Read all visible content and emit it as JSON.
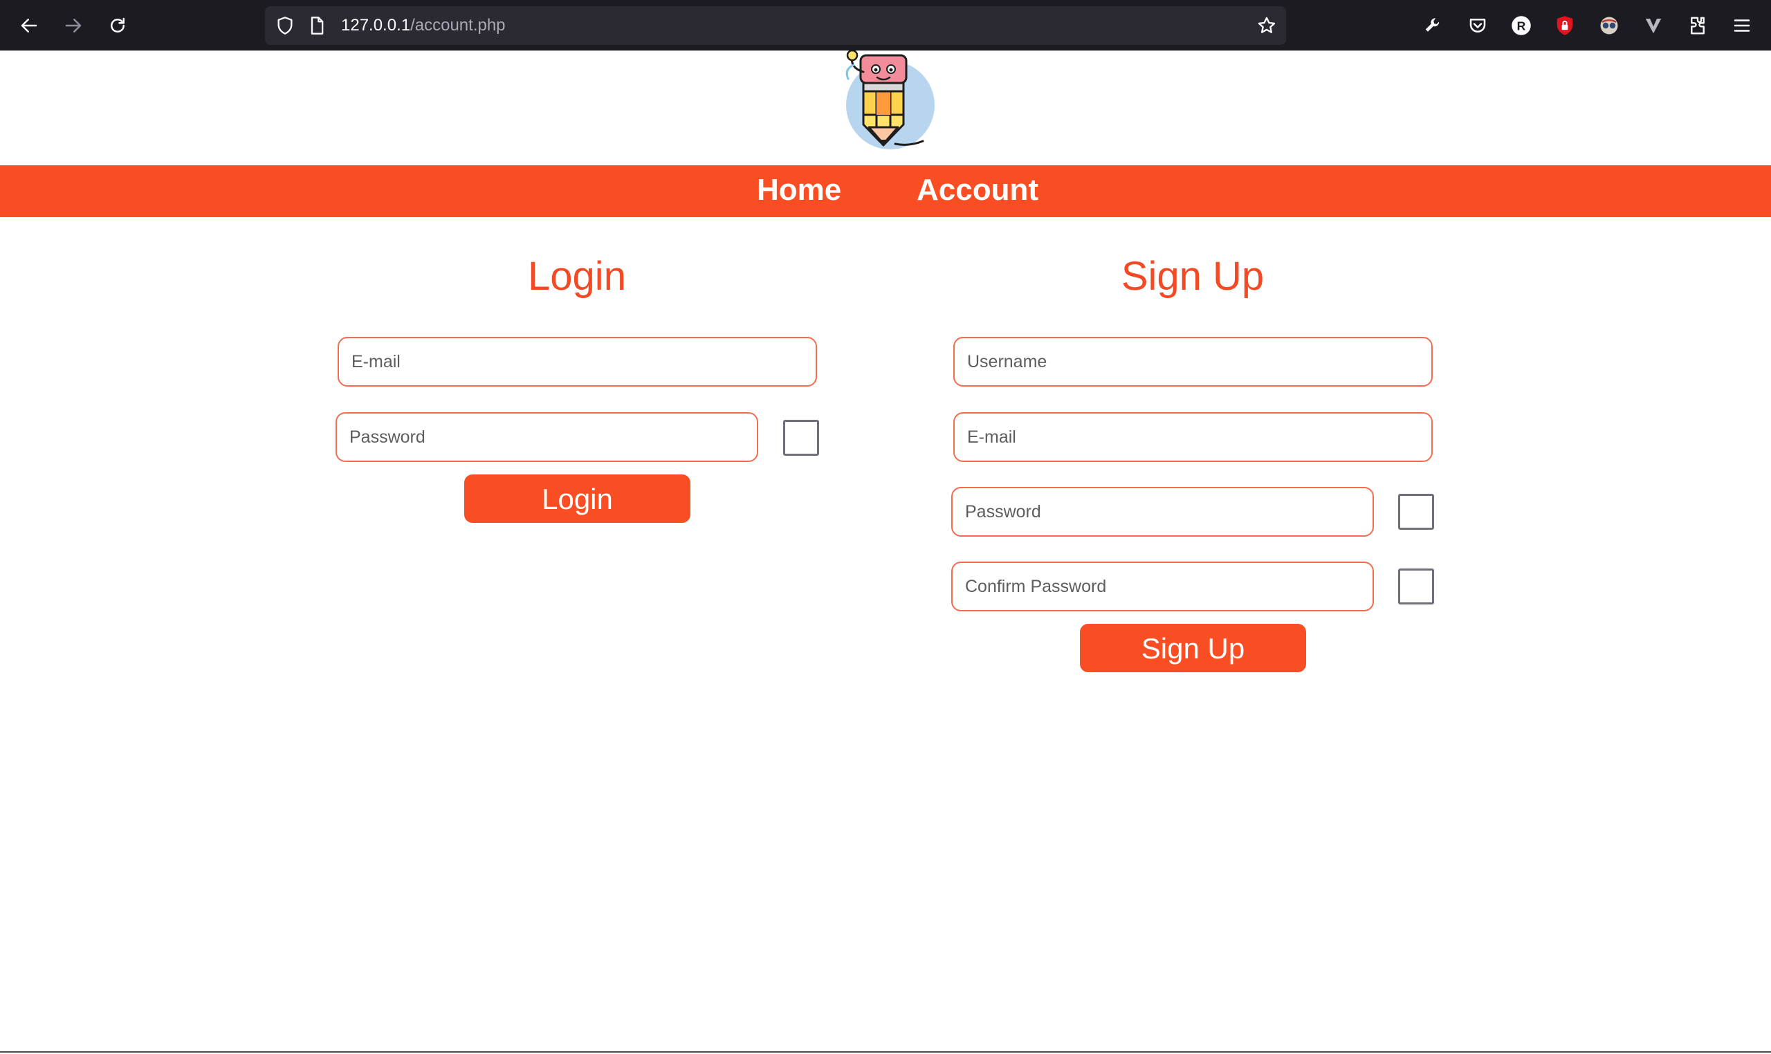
{
  "browser": {
    "url_host": "127.0.0.1",
    "url_path": "/account.php",
    "extension_badge_letter": "R"
  },
  "nav": {
    "home_label": "Home",
    "account_label": "Account"
  },
  "login": {
    "title": "Login",
    "email_placeholder": "E-mail",
    "password_placeholder": "Password",
    "button_label": "Login"
  },
  "signup": {
    "title": "Sign Up",
    "username_placeholder": "Username",
    "email_placeholder": "E-mail",
    "password_placeholder": "Password",
    "confirm_placeholder": "Confirm Password",
    "button_label": "Sign Up"
  },
  "colors": {
    "accent": "#f94d24",
    "heading": "#f24a25",
    "input_border": "#f46c4e",
    "chrome_bg": "#1c1b22"
  }
}
